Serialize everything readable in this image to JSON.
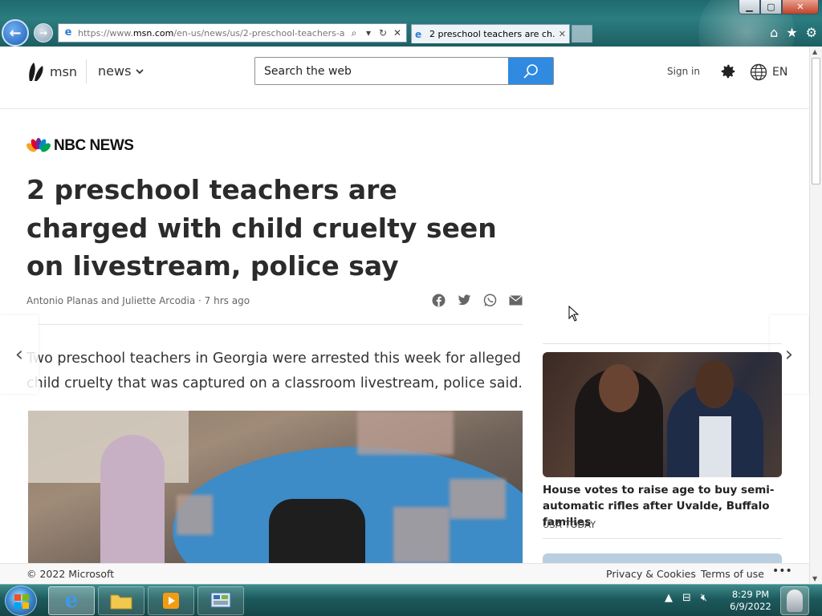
{
  "browser": {
    "url_prefix": "https://www.",
    "url_domain": "msn.com",
    "url_rest": "/en-us/news/us/2-preschool-teachers-are",
    "tab_title": "2 preschool teachers are ch...",
    "win_min": "▁",
    "win_max": "▢",
    "win_close": "✕"
  },
  "header": {
    "logo_text": "msn",
    "section": "news",
    "search_placeholder": "Search the web",
    "signin": "Sign in",
    "language": "EN"
  },
  "article": {
    "publisher": "NBC NEWS",
    "headline": "2 preschool teachers are charged with child cruelty seen on livestream, police say",
    "byline": "Antonio Planas and Juliette Arcodia · 7 hrs ago",
    "lede": "Two preschool teachers in Georgia were arrested this week for alleged child cruelty that was captured on a classroom livestream, police said."
  },
  "sidebar": {
    "story": {
      "headline": "House votes to raise age to buy semi-automatic rifles after Uvalde, Buffalo families",
      "source": "USA TODAY"
    }
  },
  "footer": {
    "copyright": "© 2022 Microsoft",
    "privacy": "Privacy & Cookies",
    "terms": "Terms of use",
    "more": "•••"
  },
  "taskbar": {
    "time": "8:29 PM",
    "date": "6/9/2022"
  },
  "colors": {
    "accent": "#2f8ae0",
    "headline": "#2b2b2b"
  }
}
